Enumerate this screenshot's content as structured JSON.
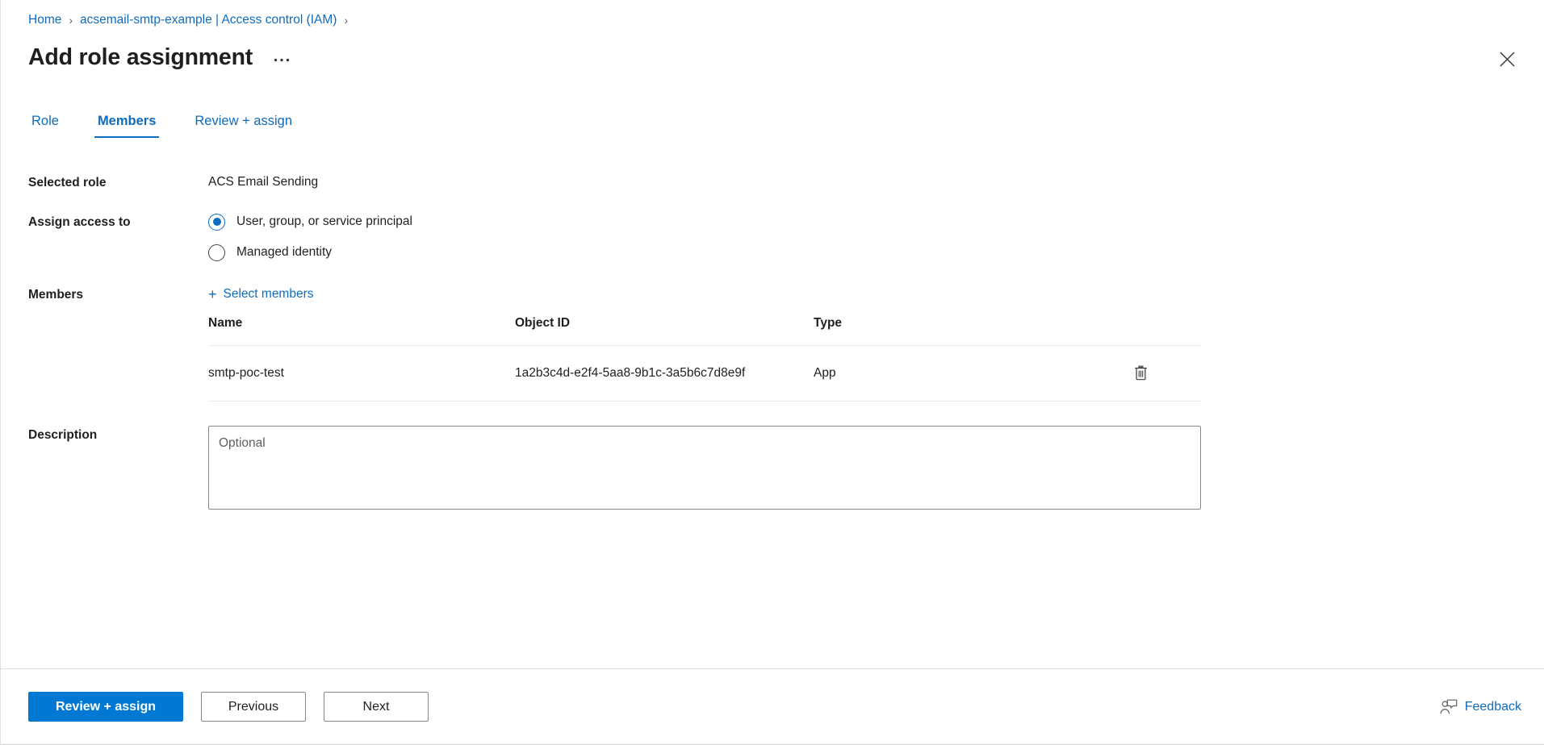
{
  "breadcrumb": {
    "items": [
      {
        "label": "Home",
        "icon": ""
      },
      {
        "label": "acsemail-smtp-example | Access control (IAM)",
        "icon": ""
      }
    ],
    "separator": "›"
  },
  "header": {
    "title": "Add role assignment",
    "more_icon": "•••",
    "more_label": "More commands",
    "close_icon": "close-icon"
  },
  "tabs": [
    {
      "label": "Role",
      "active": false
    },
    {
      "label": "Members",
      "active": true
    },
    {
      "label": "Review + assign",
      "active": false
    }
  ],
  "form": {
    "selected_role": {
      "label": "Selected role",
      "value": "ACS Email Sending"
    },
    "assign_access_to": {
      "label": "Assign access to",
      "options": [
        {
          "label": "User, group, or service principal",
          "checked": true
        },
        {
          "label": "Managed identity",
          "checked": false
        }
      ]
    },
    "members": {
      "label": "Members",
      "select_members_label": "Select members",
      "plus_icon": "+",
      "table": {
        "columns": [
          "Name",
          "Object ID",
          "Type"
        ],
        "rows": [
          {
            "name": "smtp-poc-test",
            "object_id": "1a2b3c4d-e2f4-5aa8-9b1c-3a5b6c7d8e9f",
            "type": "App",
            "delete_icon": "trash-icon"
          }
        ]
      }
    },
    "description": {
      "label": "Description",
      "placeholder": "Optional",
      "value": ""
    }
  },
  "footer": {
    "primary_button": "Review + assign",
    "previous_button": "Previous",
    "next_button": "Next",
    "feedback_label": "Feedback",
    "feedback_icon": "feedback-person-icon"
  },
  "colors": {
    "accent": "#0078d4",
    "link": "#0f6cbd",
    "text": "#201f1e",
    "border": "#e1dfdd",
    "table_border": "#edebe9",
    "input_border": "#8a8886"
  }
}
